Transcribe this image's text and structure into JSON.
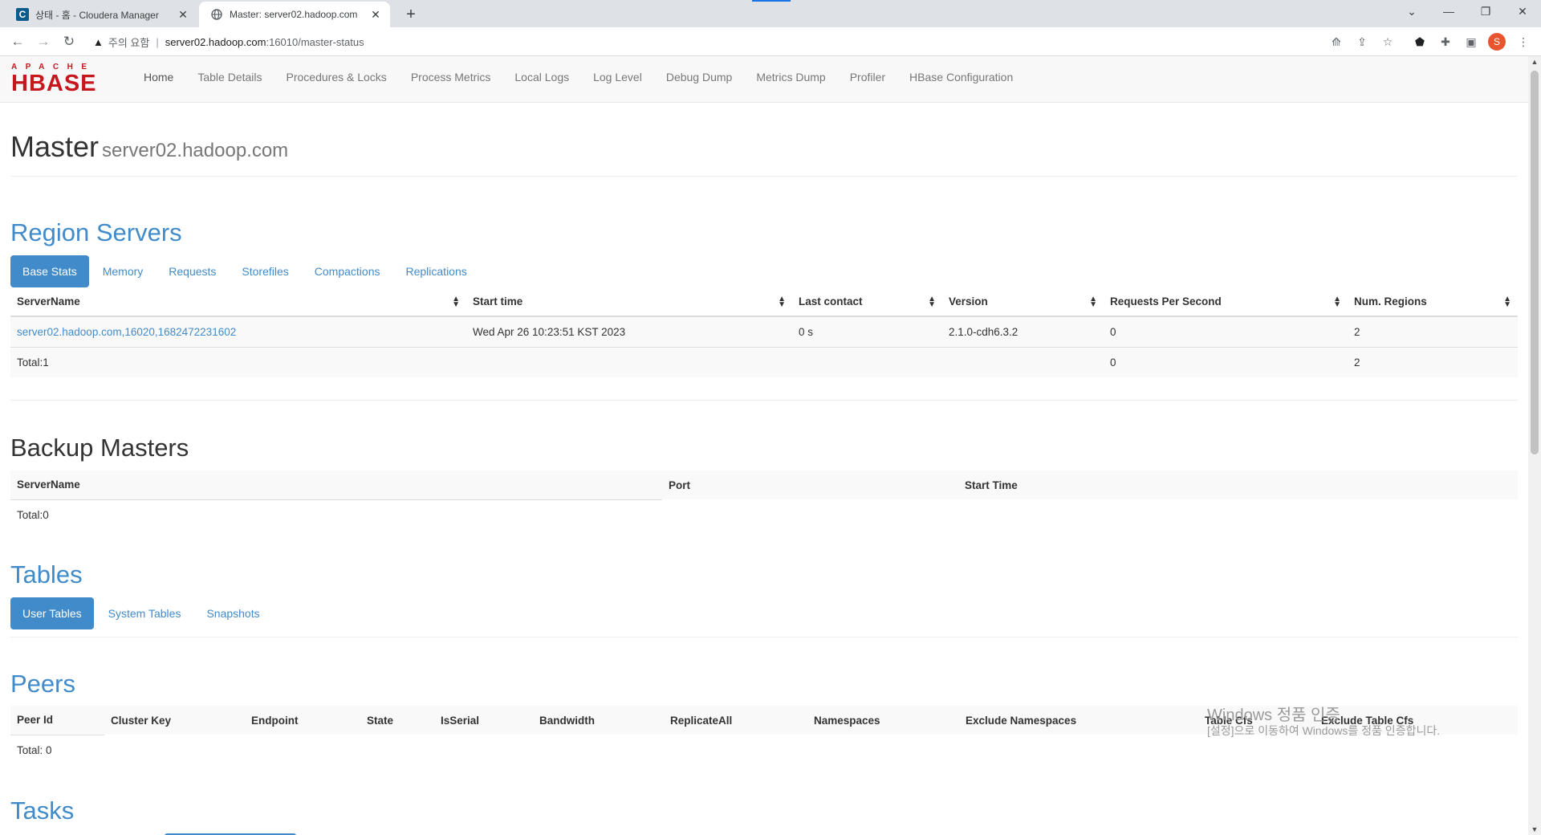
{
  "browser": {
    "tabs": [
      {
        "favicon": "C",
        "title": "상태 - 홈 - Cloudera Manager"
      },
      {
        "favicon": "globe",
        "title": "Master: server02.hadoop.com"
      }
    ],
    "address": {
      "security_label": "주의 요함",
      "host": "server02.hadoop.com",
      "path": ":16010/master-status"
    },
    "profile_initial": "S"
  },
  "logo": {
    "top": "APACHE",
    "main": "HBASE"
  },
  "nav": [
    "Home",
    "Table Details",
    "Procedures & Locks",
    "Process Metrics",
    "Local Logs",
    "Log Level",
    "Debug Dump",
    "Metrics Dump",
    "Profiler",
    "HBase Configuration"
  ],
  "header": {
    "title": "Master",
    "subtitle": "server02.hadoop.com"
  },
  "region_servers": {
    "heading": "Region Servers",
    "tabs": [
      "Base Stats",
      "Memory",
      "Requests",
      "Storefiles",
      "Compactions",
      "Replications"
    ],
    "columns": [
      "ServerName",
      "Start time",
      "Last contact",
      "Version",
      "Requests Per Second",
      "Num. Regions"
    ],
    "rows": [
      {
        "server": "server02.hadoop.com,16020,1682472231602",
        "start": "Wed Apr 26 10:23:51 KST 2023",
        "contact": "0 s",
        "version": "2.1.0-cdh6.3.2",
        "rps": "0",
        "regions": "2"
      }
    ],
    "total": {
      "label": "Total:1",
      "rps": "0",
      "regions": "2"
    }
  },
  "backup_masters": {
    "heading": "Backup Masters",
    "columns": [
      "ServerName",
      "Port",
      "Start Time"
    ],
    "total": "Total:0"
  },
  "tables": {
    "heading": "Tables",
    "tabs": [
      "User Tables",
      "System Tables",
      "Snapshots"
    ]
  },
  "peers": {
    "heading": "Peers",
    "columns": [
      "Peer Id",
      "Cluster Key",
      "Endpoint",
      "State",
      "IsSerial",
      "Bandwidth",
      "ReplicateAll",
      "Namespaces",
      "Exclude Namespaces",
      "Table Cfs",
      "Exclude Table Cfs"
    ],
    "total": "Total: 0"
  },
  "tasks": {
    "heading": "Tasks"
  },
  "watermark": {
    "line1": "Windows 정품 인증",
    "line2": "[설정]으로 이동하여 Windows를 정품 인증합니다."
  }
}
